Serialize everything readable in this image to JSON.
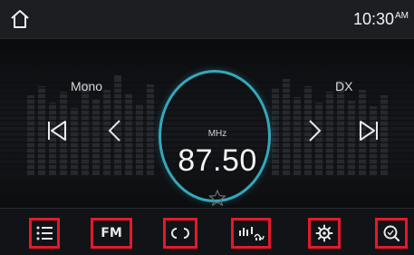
{
  "status": {
    "time": "10:30",
    "ampm": "AM"
  },
  "radio": {
    "mode_left": "Mono",
    "mode_right": "DX",
    "unit": "MHz",
    "frequency": "87.50"
  },
  "bottom_nav": {
    "band_label": "FM",
    "items": [
      {
        "icon": "list-icon"
      },
      {
        "icon": "band-fm"
      },
      {
        "icon": "loop-icon"
      },
      {
        "icon": "signal-icon"
      },
      {
        "icon": "gear-icon"
      },
      {
        "icon": "search-icon"
      }
    ]
  },
  "colors": {
    "accent_ring": "#35a7ba",
    "highlight_box": "#e4192b"
  }
}
